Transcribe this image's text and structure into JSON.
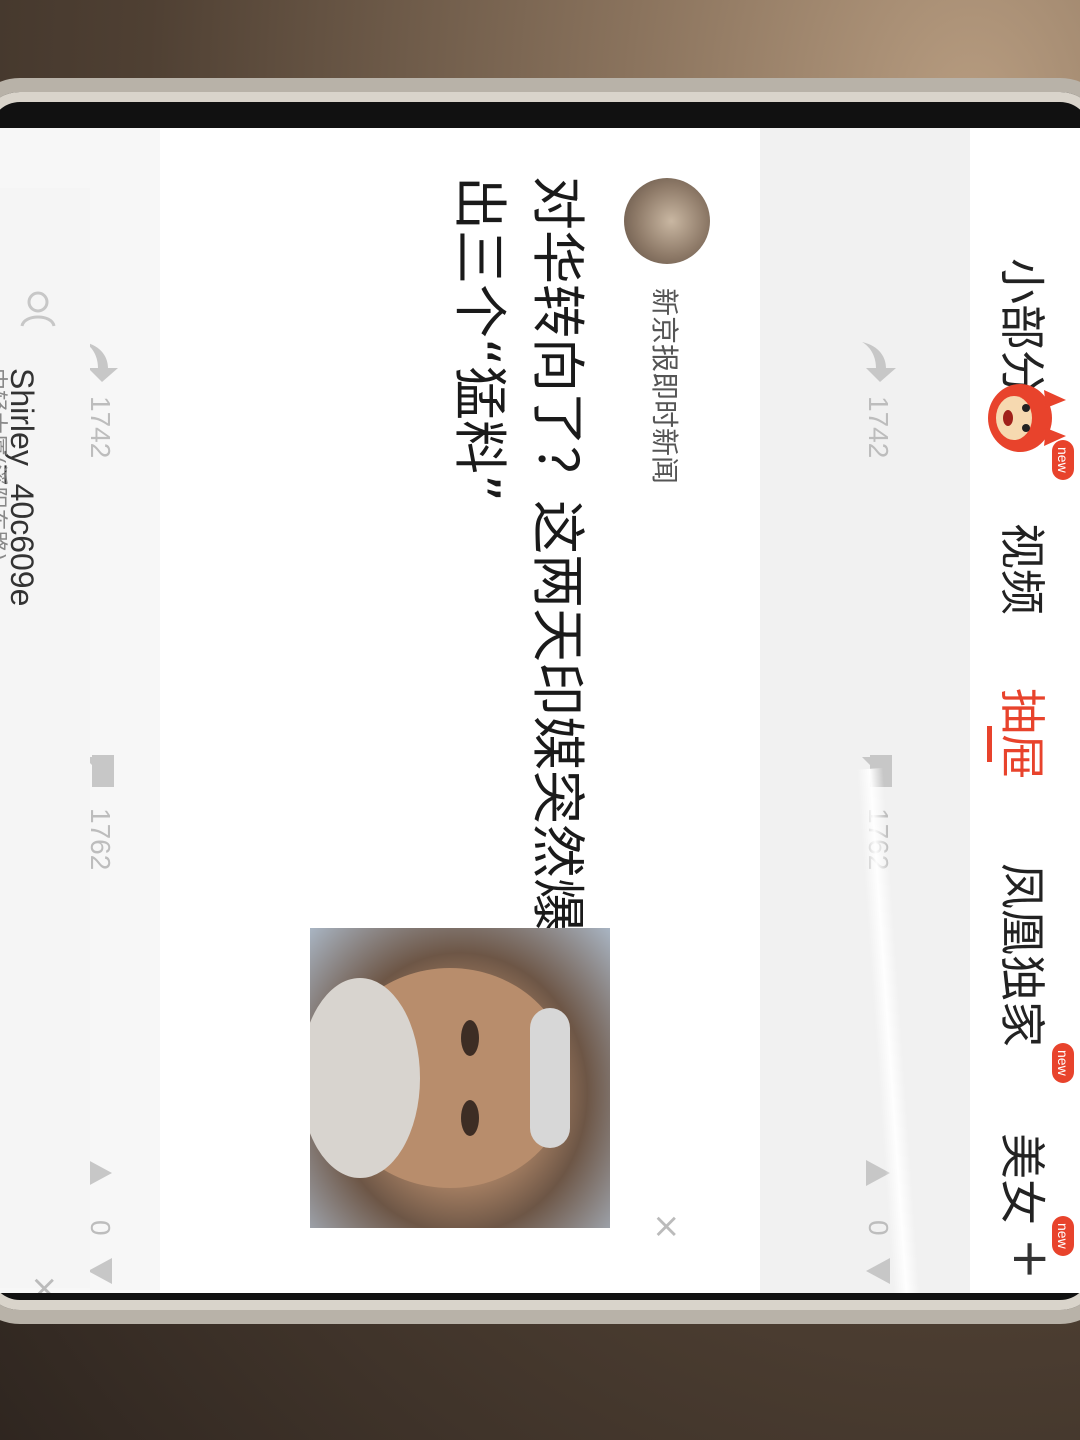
{
  "nav": {
    "partial_tab": "小部分子",
    "tabs": [
      {
        "label": "视频",
        "badge": ""
      },
      {
        "label": "抽屉",
        "badge": ""
      },
      {
        "label": "凤凰独家",
        "badge": "new"
      },
      {
        "label": "美女",
        "badge": "new"
      }
    ],
    "mascot_badge": "new",
    "plus": "+"
  },
  "top_row": {
    "share_count": "1742",
    "comment_count": "1762",
    "vote_count": "0"
  },
  "article": {
    "source": "新京报即时新闻",
    "headline": "对华转向了？这两天印媒突然爆出三个“猛料”",
    "share_count": "1742",
    "comment_count": "1762",
    "vote_count": "0",
    "close": "×"
  },
  "bottom_row": {
    "author": "Shirley_40c609e",
    "author_sub": "中轻大厦(溪阳东路)",
    "close": "×"
  },
  "icons": [
    "share-icon",
    "comment-icon",
    "upvote-icon",
    "downvote-icon",
    "close-icon",
    "plus-icon",
    "user-icon"
  ],
  "colors": {
    "accent": "#e8432c",
    "background": "#f1f1f1"
  }
}
